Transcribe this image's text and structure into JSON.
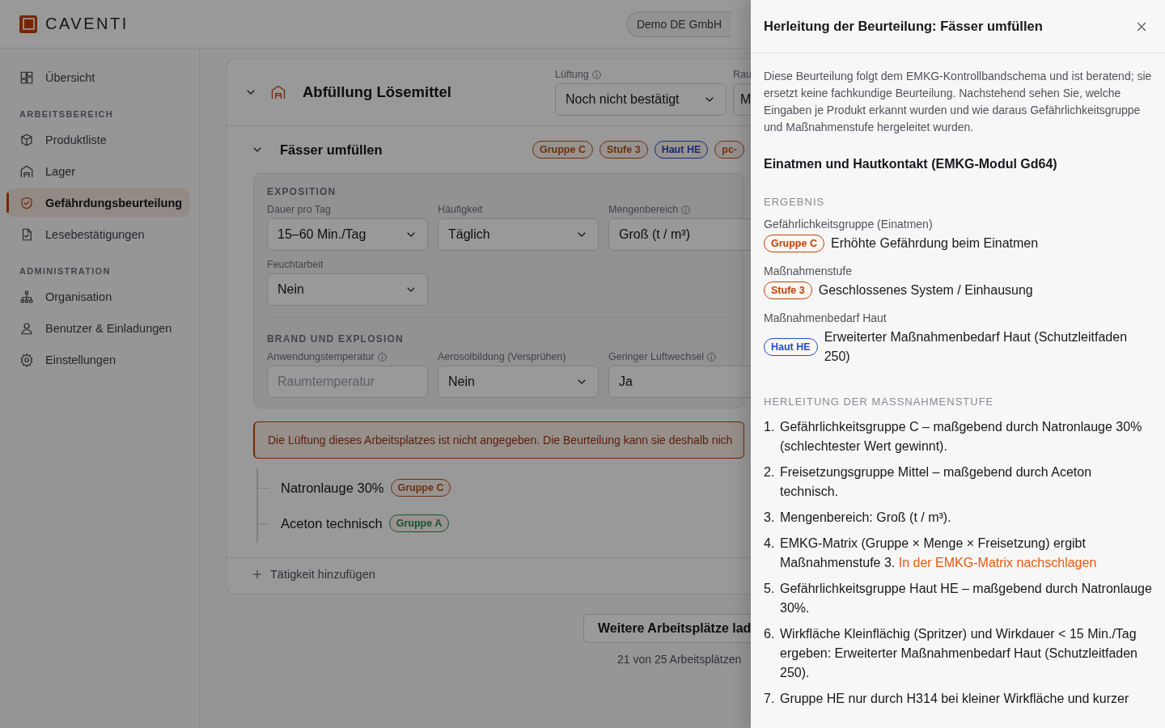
{
  "brand": {
    "name": "CAVENTI"
  },
  "org_switcher": {
    "label": "Demo DE GmbH"
  },
  "sidebar": {
    "sections": [
      {
        "items": [
          {
            "label": "Übersicht",
            "selected": false
          }
        ]
      },
      {
        "heading": "ARBEITSBEREICH",
        "items": [
          {
            "label": "Produktliste",
            "selected": false
          },
          {
            "label": "Lager",
            "selected": false
          },
          {
            "label": "Gefährdungsbeurteilung",
            "selected": true
          },
          {
            "label": "Lesebestätigungen",
            "selected": false
          }
        ]
      },
      {
        "heading": "ADMINISTRATION",
        "items": [
          {
            "label": "Organisation",
            "selected": false
          },
          {
            "label": "Benutzer & Einladungen",
            "selected": false
          },
          {
            "label": "Einstellungen",
            "selected": false
          }
        ]
      }
    ]
  },
  "workplace": {
    "title": "Abfüllung Lösemittel",
    "expanded": true,
    "fields": [
      {
        "label": "Lüftung",
        "info": true,
        "value": "Noch nicht bestätigt"
      },
      {
        "label": "Rau",
        "value": "M"
      }
    ],
    "activity": {
      "title": "Fässer umfüllen",
      "expanded": true,
      "badges": [
        {
          "label": "Gruppe C",
          "kind": "warning"
        },
        {
          "label": "Stufe 3",
          "kind": "warning"
        },
        {
          "label": "Haut HE",
          "kind": "info"
        },
        {
          "label": "pc-",
          "kind": "warning"
        }
      ],
      "sections": [
        {
          "heading": "EXPOSITION",
          "fields": [
            {
              "label": "Dauer pro Tag",
              "info": false,
              "kind": "select",
              "value": "15–60 Min./Tag"
            },
            {
              "label": "Häufigkeit",
              "info": false,
              "kind": "select",
              "value": "Täglich"
            },
            {
              "label": "Mengenbereich",
              "info": true,
              "kind": "select",
              "value": "Groß (t / m³)"
            },
            {
              "label": "Feuchtarbeit",
              "info": false,
              "kind": "select",
              "value": "Nein"
            }
          ]
        },
        {
          "heading": "BRAND UND EXPLOSION",
          "fields": [
            {
              "label": "Anwendungstemperatur",
              "info": true,
              "kind": "input",
              "placeholder": "Raumtemperatur"
            },
            {
              "label": "Aerosolbildung (Versprühen)",
              "info": false,
              "kind": "select",
              "value": "Nein"
            },
            {
              "label": "Geringer Luftwechsel",
              "info": true,
              "kind": "select",
              "value": "Ja"
            }
          ]
        }
      ],
      "warning": "Die Lüftung dieses Arbeitsplatzes ist nicht angegeben. Die Beurteilung kann sie deshalb nich",
      "products": [
        {
          "name": "Natronlauge 30%",
          "badge": {
            "label": "Gruppe C",
            "kind": "warning"
          }
        },
        {
          "name": "Aceton technisch",
          "badge": {
            "label": "Gruppe A",
            "kind": "success"
          }
        }
      ]
    },
    "add_activity": "Tätigkeit hinzufügen"
  },
  "load_more": {
    "button": "Weitere Arbeitsplätze lad",
    "count": "21 von 25 Arbeitsplätzen"
  },
  "drawer": {
    "title": "Herleitung der Beurteilung: Fässer umfüllen",
    "intro": "Diese Beurteilung folgt dem EMKG-Kontrollbandschema und ist beratend; sie ersetzt keine fachkundige Beurteilung. Nachstehend sehen Sie, welche Eingaben je Produkt erkannt wurden und wie daraus Gefährlichkeitsgruppe und Maßnahmenstufe hergeleitet wurden.",
    "section_title": "Einatmen und Hautkontakt (EMKG-Modul Gd64)",
    "result_heading": "ERGEBNIS",
    "results": [
      {
        "label": "Gefährlichkeitsgruppe (Einatmen)",
        "badge": {
          "label": "Gruppe C",
          "color": "#c2410c"
        },
        "text": "Erhöhte Gefährdung beim Einatmen"
      },
      {
        "label": "Maßnahmenstufe",
        "badge": {
          "label": "Stufe 3",
          "color": "#c2410c"
        },
        "text": "Geschlossenes System / Einhausung"
      },
      {
        "label": "Maßnahmenbedarf Haut",
        "badge": {
          "label": "Haut HE",
          "color": "#1d4ed8"
        },
        "text": "Erweiterter Maßnahmenbedarf Haut (Schutzleitfaden 250)"
      }
    ],
    "derivation_heading": "HERLEITUNG DER MASSNAHMENSTUFE",
    "steps": [
      {
        "number": "1.",
        "text": "Gefährlichkeitsgruppe C – maßgebend durch Natronlauge 30% (schlechtester Wert gewinnt)."
      },
      {
        "number": "2.",
        "text": "Freisetzungsgruppe Mittel – maßgebend durch Aceton technisch."
      },
      {
        "number": "3.",
        "text": "Mengenbereich: Groß (t / m³)."
      },
      {
        "number": "4.",
        "text": "EMKG-Matrix (Gruppe × Menge × Freisetzung) ergibt Maßnahmenstufe 3.",
        "link": "In der EMKG-Matrix nachschlagen"
      },
      {
        "number": "5.",
        "text": "Gefährlichkeitsgruppe Haut HE – maßgebend durch Natronlauge 30%."
      },
      {
        "number": "6.",
        "text": "Wirkfläche Kleinflächig (Spritzer) und Wirkdauer < 15 Min./Tag ergeben: Erweiterter Maßnahmenbedarf Haut (Schutzleitfaden 250)."
      },
      {
        "number": "7.",
        "text": "Gruppe HE nur durch H314 bei kleiner Wirkfläche und kurzer"
      }
    ]
  }
}
